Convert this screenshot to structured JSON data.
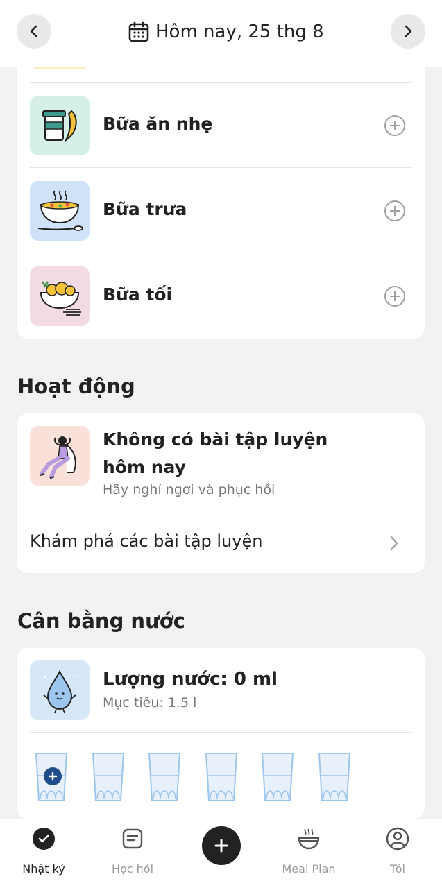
{
  "header": {
    "date_label": "Hôm nay, 25 thg 8",
    "prev_icon": "chevron-left-icon",
    "next_icon": "chevron-right-icon",
    "calendar_icon": "calendar-icon"
  },
  "meals": [
    {
      "label": "Bữa ăn nhẹ",
      "icon": "snack-coffee-banana-icon",
      "tile_color": "#d5efe9"
    },
    {
      "label": "Bữa trưa",
      "icon": "soup-bowl-icon",
      "tile_color": "#cfe2f8"
    },
    {
      "label": "Bữa tối",
      "icon": "pasta-plate-icon",
      "tile_color": "#f3dbe6"
    }
  ],
  "activity": {
    "section_title": "Hoạt động",
    "title": "Không có bài tập luyện hôm nay",
    "subtitle": "Hãy nghỉ ngơi và phục hồi",
    "explore_label": "Khám phá các bài tập luyện",
    "tile_color": "#f9e1da"
  },
  "water": {
    "section_title": "Cân bằng nước",
    "title": "Lượng nước: 0 ml",
    "goal": "Mục tiêu: 1.5 l",
    "glasses_filled": 0,
    "glasses_total": 6,
    "tile_color": "#d6e7f7"
  },
  "tabs": [
    {
      "label": "Nhật ký",
      "icon": "check-circle-icon",
      "active": true
    },
    {
      "label": "Học hỏi",
      "icon": "document-icon",
      "active": false
    },
    {
      "label": "",
      "icon": "plus-icon",
      "active": false
    },
    {
      "label": "Meal Plan",
      "icon": "bowl-icon",
      "active": false
    },
    {
      "label": "Tôi",
      "icon": "profile-icon",
      "active": false
    }
  ],
  "colors": {
    "background": "#f2f2f4",
    "card": "#ffffff",
    "accent_dark": "#222222",
    "water_blue": "#1f4e8a",
    "muted_text": "#777777"
  }
}
